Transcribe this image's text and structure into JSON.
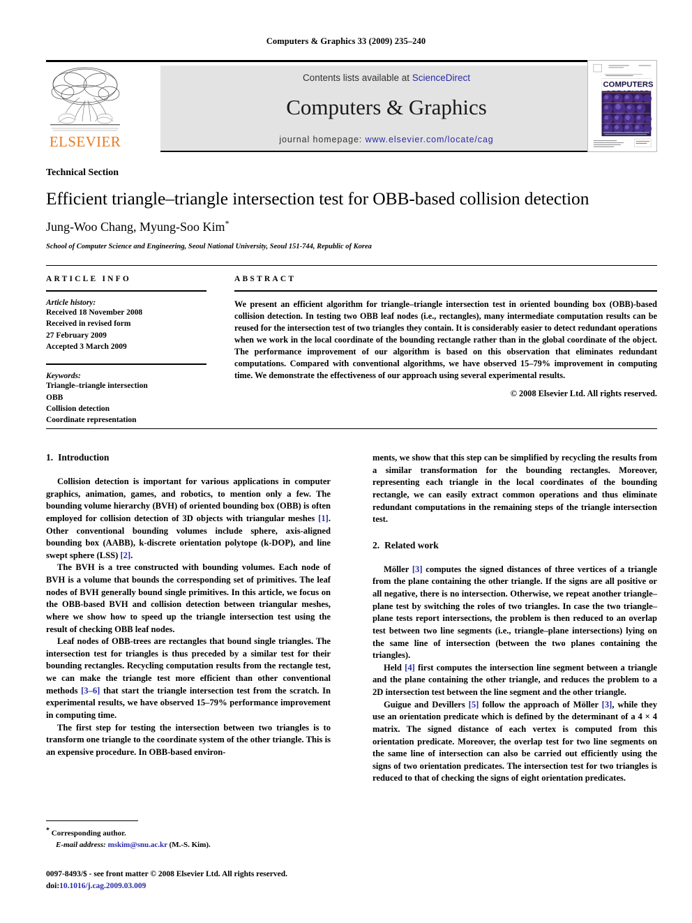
{
  "running_head": "Computers & Graphics 33 (2009) 235–240",
  "masthead": {
    "contents_prefix": "Contents lists available at ",
    "contents_link": "ScienceDirect",
    "journal_title": "Computers & Graphics",
    "homepage_prefix": "journal homepage: ",
    "homepage_link": "www.elsevier.com/locate/cag",
    "publisher_wordmark": "ELSEVIER",
    "cover": {
      "line1": "COMPUTERS",
      "line2": "&GRAPHICS"
    }
  },
  "title_block": {
    "kicker": "Technical Section",
    "title": "Efficient triangle–triangle intersection test for OBB-based collision detection",
    "authors": "Jung-Woo Chang, Myung-Soo Kim",
    "corresponding_marker": "*",
    "affiliation": "School of Computer Science and Engineering, Seoul National University, Seoul 151-744, Republic of Korea"
  },
  "article_info": {
    "heading": "ARTICLE INFO",
    "history_label": "Article history:",
    "history_lines": [
      "Received 18 November 2008",
      "Received in revised form",
      "27 February 2009",
      "Accepted 3 March 2009"
    ],
    "keywords_label": "Keywords:",
    "keywords": [
      "Triangle–triangle intersection",
      "OBB",
      "Collision detection",
      "Coordinate representation"
    ]
  },
  "abstract": {
    "heading": "ABSTRACT",
    "text": "We present an efficient algorithm for triangle–triangle intersection test in oriented bounding box (OBB)-based collision detection. In testing two OBB leaf nodes (i.e., rectangles), many intermediate computation results can be reused for the intersection test of two triangles they contain. It is considerably easier to detect redundant operations when we work in the local coordinate of the bounding rectangle rather than in the global coordinate of the object. The performance improvement of our algorithm is based on this observation that eliminates redundant computations. Compared with conventional algorithms, we have observed 15–79% improvement in computing time. We demonstrate the effectiveness of our approach using several experimental results.",
    "copyright": "© 2008 Elsevier Ltd. All rights reserved."
  },
  "sections": {
    "intro": {
      "number": "1.",
      "title": "Introduction",
      "p1_a": "Collision detection is important for various applications in computer graphics, animation, games, and robotics, to mention only a few. The bounding volume hierarchy (BVH) of oriented bounding box (OBB) is often employed for collision detection of 3D objects with triangular meshes ",
      "p1_cite1": "[1]",
      "p1_b": ". Other conventional bounding volumes include sphere, axis-aligned bounding box (AABB), k-discrete orientation polytope (k-DOP), and line swept sphere (LSS) ",
      "p1_cite2": "[2]",
      "p1_c": ".",
      "p2": "The BVH is a tree constructed with bounding volumes. Each node of BVH is a volume that bounds the corresponding set of primitives. The leaf nodes of BVH generally bound single primitives. In this article, we focus on the OBB-based BVH and collision detection between triangular meshes, where we show how to speed up the triangle intersection test using the result of checking OBB leaf nodes.",
      "p3_a": "Leaf nodes of OBB-trees are rectangles that bound single triangles. The intersection test for triangles is thus preceded by a similar test for their bounding rectangles. Recycling computation results from the rectangle test, we can make the triangle test more efficient than other conventional methods ",
      "p3_cite": "[3–6]",
      "p3_b": " that start the triangle intersection test from the scratch. In experimental results, we have observed 15–79% performance improvement in computing time.",
      "p4": "The first step for testing the intersection between two triangles is to transform one triangle to the coordinate system of the other triangle. This is an expensive procedure. In OBB-based environ-",
      "p4_cont": "ments, we show that this step can be simplified by recycling the results from a similar transformation for the bounding rectangles. Moreover, representing each triangle in the local coordinates of the bounding rectangle, we can easily extract common operations and thus eliminate redundant computations in the remaining steps of the triangle intersection test."
    },
    "related": {
      "number": "2.",
      "title": "Related work",
      "p1_a": "Möller ",
      "p1_cite": "[3]",
      "p1_b": " computes the signed distances of three vertices of a triangle from the plane containing the other triangle. If the signs are all positive or all negative, there is no intersection. Otherwise, we repeat another triangle–plane test by switching the roles of two triangles. In case the two triangle–plane tests report intersections, the problem is then reduced to an overlap test between two line segments (i.e., triangle–plane intersections) lying on the same line of intersection (between the two planes containing the triangles).",
      "p2_a": "Held ",
      "p2_cite": "[4]",
      "p2_b": " first computes the intersection line segment between a triangle and the plane containing the other triangle, and reduces the problem to a 2D intersection test between the line segment and the other triangle.",
      "p3_a": "Guigue and Devillers ",
      "p3_cite1": "[5]",
      "p3_b": " follow the approach of Möller ",
      "p3_cite2": "[3]",
      "p3_c": ", while they use an orientation predicate which is defined by the determinant of a 4 × 4 matrix. The signed distance of each vertex is computed from this orientation predicate. Moreover, the overlap test for two line segments on the same line of intersection can also be carried out efficiently using the signs of two orientation predicates. The intersection test for two triangles is reduced to that of checking the signs of eight orientation predicates."
    }
  },
  "footnote": {
    "corresponding_marker": "*",
    "corresponding_text": " Corresponding author.",
    "email_label": "E-mail address:",
    "email": "mskim@snu.ac.kr",
    "email_owner": "(M.-S. Kim)."
  },
  "footer": {
    "line1": "0097-8493/$ - see front matter © 2008 Elsevier Ltd. All rights reserved.",
    "doi_label": "doi:",
    "doi": "10.1016/j.cag.2009.03.009"
  },
  "colors": {
    "link": "#2a2aa8",
    "elsevier_orange": "#E87B1E",
    "band_gray": "#e3e3e3"
  }
}
